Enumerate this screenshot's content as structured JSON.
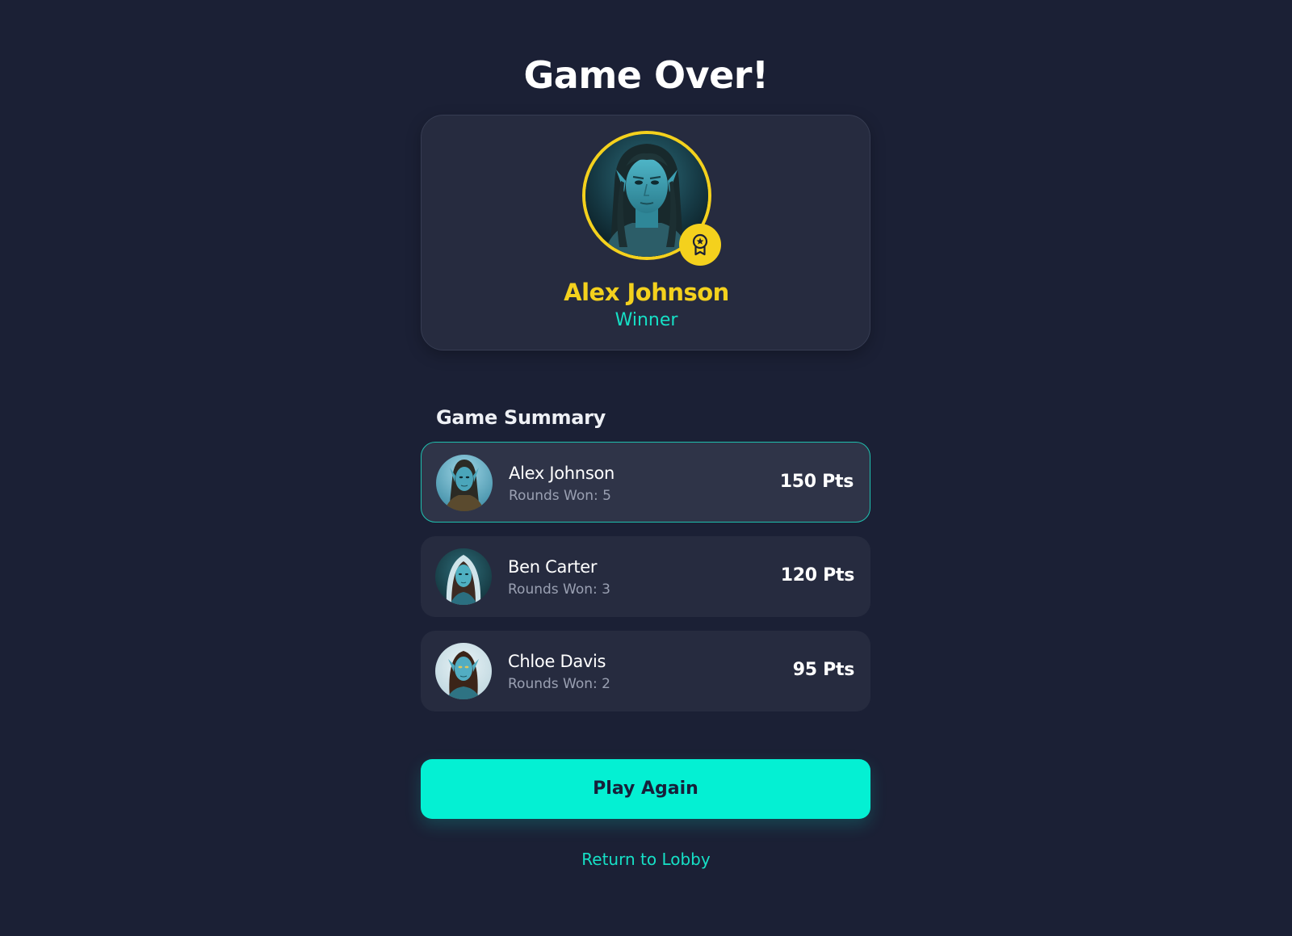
{
  "page": {
    "title": "Game Over!"
  },
  "winner": {
    "name": "Alex Johnson",
    "label": "Winner",
    "badge_icon": "award-ribbon-icon",
    "accent_color": "#f4d11d"
  },
  "summary": {
    "title": "Game Summary",
    "players": [
      {
        "name": "Alex Johnson",
        "rounds": "Rounds Won: 5",
        "points": "150 Pts",
        "highlighted": true
      },
      {
        "name": "Ben Carter",
        "rounds": "Rounds Won: 3",
        "points": "120 Pts",
        "highlighted": false
      },
      {
        "name": "Chloe Davis",
        "rounds": "Rounds Won: 2",
        "points": "95 Pts",
        "highlighted": false
      }
    ]
  },
  "actions": {
    "play_again": "Play Again",
    "return_lobby": "Return to Lobby"
  },
  "colors": {
    "background": "#1b2035",
    "primary": "#04f0d3",
    "teal_text": "#16e0c6",
    "gold": "#f4d11d"
  }
}
